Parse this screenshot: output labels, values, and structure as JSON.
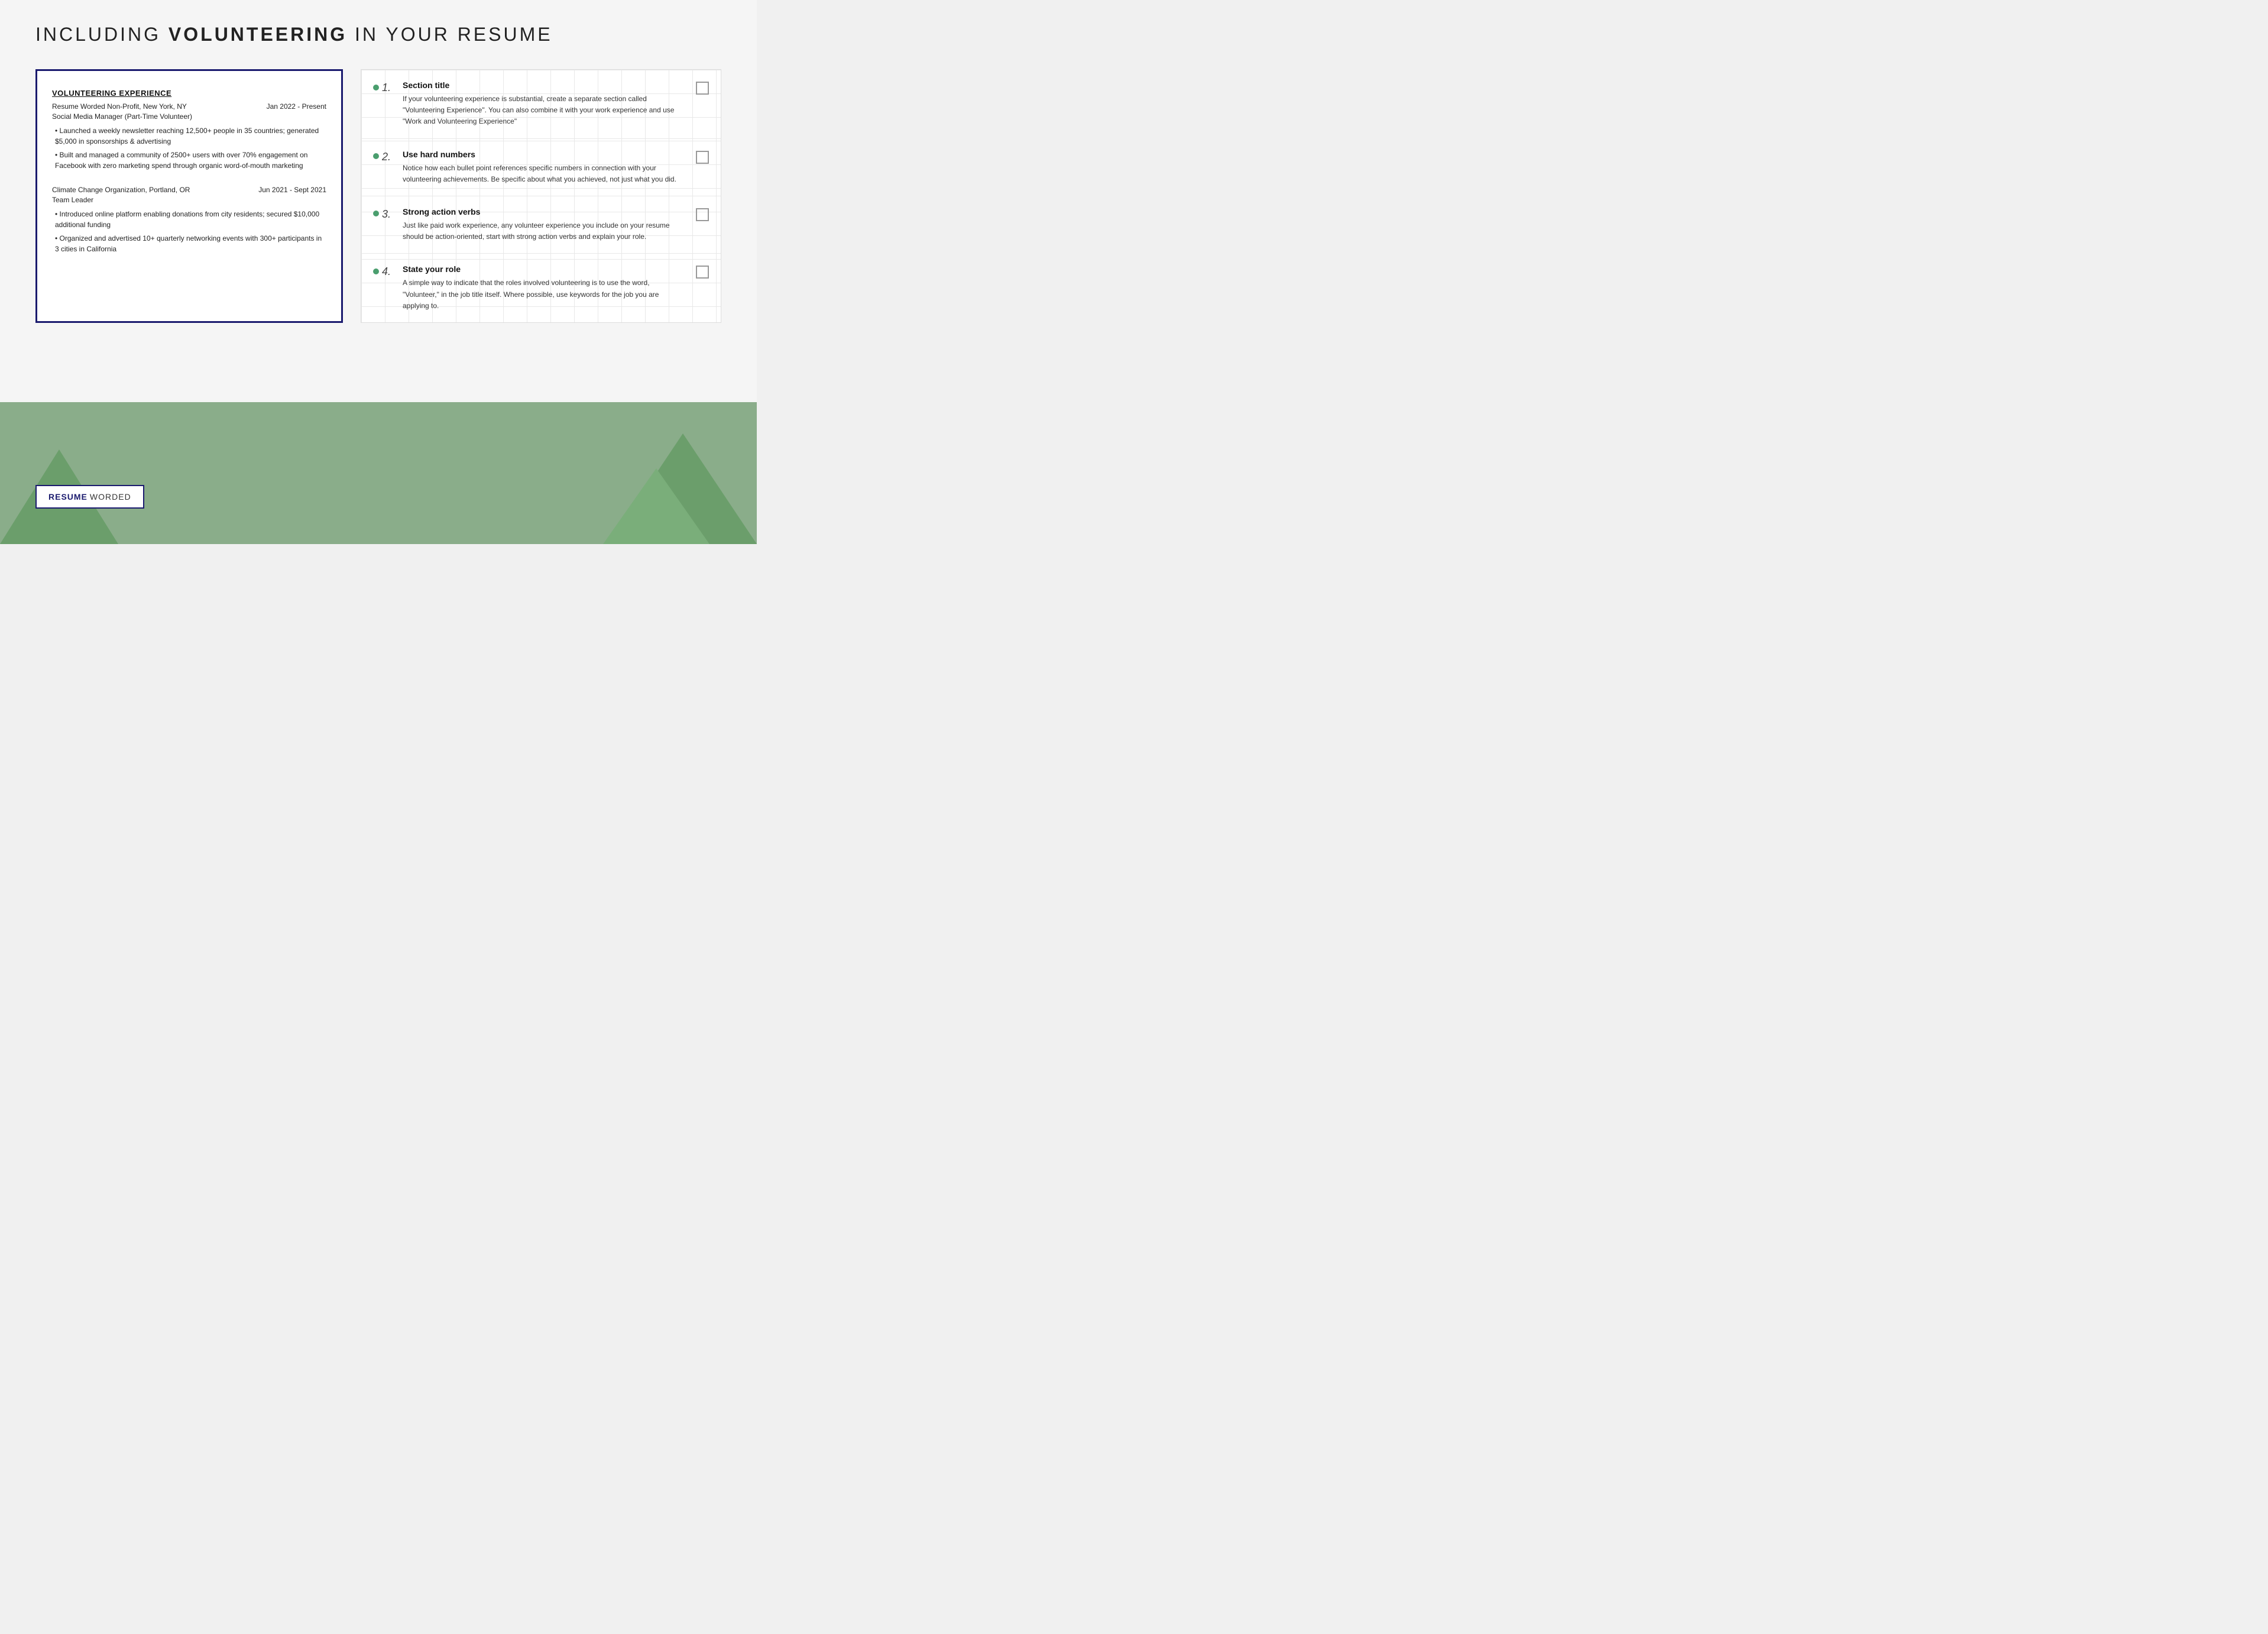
{
  "page": {
    "title_light": "INCLUDING ",
    "title_bold": "VOLUNTEERING",
    "title_end": " IN YOUR RESUME"
  },
  "resume": {
    "section_title": "VOLUNTEERING EXPERIENCE",
    "job1": {
      "org": "Resume Worded Non-Profit, New York, NY",
      "dates": "Jan 2022 - Present",
      "role": "Social Media Manager (Part-Time Volunteer)",
      "bullets": [
        "• Launched a weekly newsletter reaching 12,500+ people in 35 countries; generated $5,000 in sponsorships & advertising",
        "• Built and managed a community of 2500+ users with over 70% engagement on Facebook with zero marketing spend through organic word-of-mouth marketing"
      ]
    },
    "job2": {
      "org": "Climate Change Organization, Portland, OR",
      "dates": "Jun 2021 - Sept 2021",
      "role": "Team Leader",
      "bullets": [
        "• Introduced online platform enabling donations from city residents; secured $10,000 additional funding",
        "• Organized and advertised 10+ quarterly networking events with 300+ participants in 3 cities in California"
      ]
    }
  },
  "tips": [
    {
      "number": "1.",
      "title": "Section title",
      "description": "If your volunteering experience is substantial, create a separate section called \"Volunteering Experience\". You can also combine it with your work experience and use \"Work and Volunteering Experience\""
    },
    {
      "number": "2.",
      "title": "Use hard numbers",
      "description": "Notice how each bullet point references specific numbers in connection with your volunteering achievements. Be specific about what you achieved, not just what you did."
    },
    {
      "number": "3.",
      "title": "Strong action verbs",
      "description": "Just like paid work experience, any volunteer experience you include on your resume should be action-oriented, start with strong action verbs and explain your role."
    },
    {
      "number": "4.",
      "title": "State your role",
      "description": "A simple way to indicate that the roles involved volunteering is to use the word, \"Volunteer,\" in the job title itself. Where possible, use keywords for the job you are applying to."
    }
  ],
  "logo": {
    "resume": "RESUME",
    "worded": "WORDED"
  }
}
